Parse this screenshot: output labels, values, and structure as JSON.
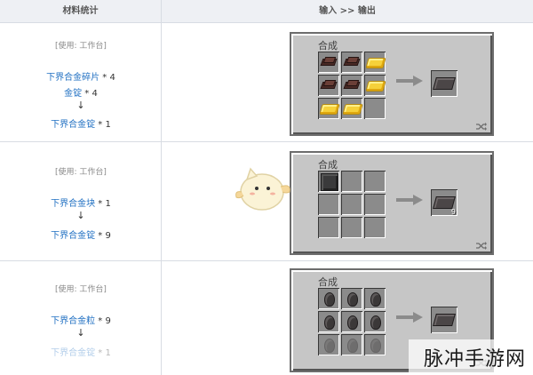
{
  "header": {
    "col1": "材料统计",
    "col2": "输入 >> 输出"
  },
  "rows": [
    {
      "use_label": "[使用: 工作台]",
      "lines": [
        {
          "item": "下界合金碎片",
          "qty": " * 4"
        },
        {
          "item": "金锭",
          "qty": " * 4"
        }
      ],
      "arrow": "↓",
      "result": {
        "item": "下界合金锭",
        "qty": " * 1"
      },
      "panel_title": "合成",
      "grid": [
        "scrap",
        "scrap",
        "gold",
        "scrap",
        "scrap",
        "gold",
        "gold",
        "gold",
        ""
      ],
      "output": "ingot",
      "output_qty": ""
    },
    {
      "use_label": "[使用: 工作台]",
      "lines": [
        {
          "item": "下界合金块",
          "qty": " * 1"
        }
      ],
      "arrow": "↓",
      "result": {
        "item": "下界合金锭",
        "qty": " * 9"
      },
      "panel_title": "合成",
      "grid": [
        "block",
        "",
        "",
        "",
        "",
        "",
        "",
        "",
        ""
      ],
      "output": "ingot",
      "output_qty": "9"
    },
    {
      "use_label": "[使用: 工作台]",
      "lines": [
        {
          "item": "下界合金粒",
          "qty": " * 9"
        }
      ],
      "arrow": "↓",
      "result": {
        "item": "下界合金锭",
        "qty": " * 1"
      },
      "panel_title": "合成",
      "grid": [
        "nugget",
        "nugget",
        "nugget",
        "nugget",
        "nugget",
        "nugget",
        "nugget",
        "nugget",
        "nugget"
      ],
      "output": "ingot",
      "output_qty": ""
    }
  ],
  "watermark": "脉冲手游网",
  "colors": {
    "link": "#1f6fc2",
    "panel": "#c6c6c6",
    "slot": "#8b8b8b"
  },
  "icons": {
    "arrow": "right-arrow-icon",
    "shuffle": "shuffle-icon",
    "mascot": "mascot-icon"
  }
}
